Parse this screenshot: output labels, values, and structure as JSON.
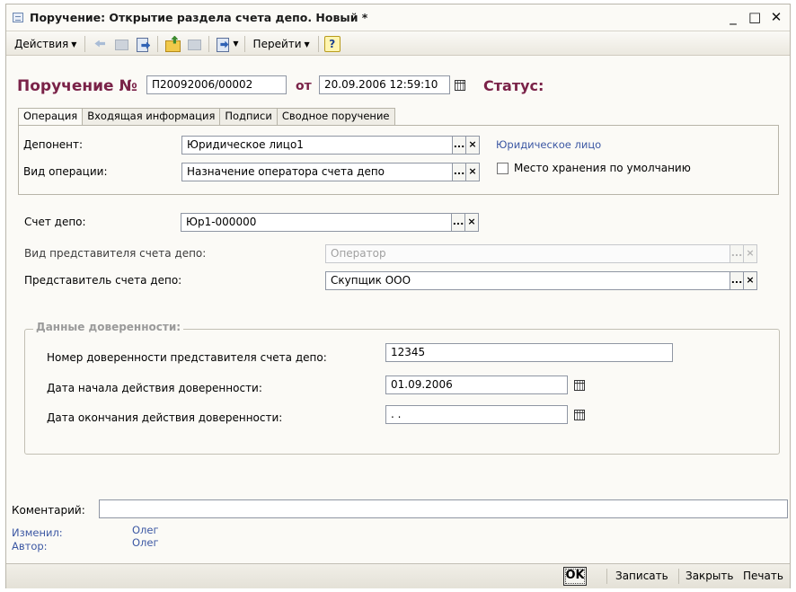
{
  "window": {
    "title": "Поручение: Открытие раздела счета депо. Новый *",
    "minimize": "_",
    "maximize": "□",
    "close": "✕"
  },
  "toolbar": {
    "actions_label": "Действия",
    "goto_label": "Перейти",
    "help_label": "?"
  },
  "header": {
    "order_label": "Поручение №",
    "order_number": "П20092006/00002",
    "from_label": "от",
    "date": "20.09.2006 12:59:10",
    "status_label": "Статус:"
  },
  "tabs": [
    {
      "label": "Операция",
      "active": true
    },
    {
      "label": "Входящая информация",
      "active": false
    },
    {
      "label": "Подписи",
      "active": false
    },
    {
      "label": "Сводное поручение",
      "active": false
    }
  ],
  "operation": {
    "deponent_label": "Депонент:",
    "deponent_value": "Юридическое лицо1",
    "deponent_type": "Юридическое лицо",
    "op_type_label": "Вид операции:",
    "op_type_value": "Назначение оператора счета депо",
    "default_storage_label": "Место хранения по умолчанию",
    "default_storage_checked": false
  },
  "account": {
    "label": "Счет депо:",
    "value": "Юр1-000000"
  },
  "rep_type": {
    "label": "Вид представителя счета депо:",
    "value": "Оператор"
  },
  "representative": {
    "label": "Представитель счета депо:",
    "value": "Скупщик ООО"
  },
  "proxy": {
    "title": "Данные доверенности:",
    "number_label": "Номер доверенности представителя счета депо:",
    "number_value": "12345",
    "start_label": "Дата начала действия доверенности:",
    "start_value": "01.09.2006",
    "end_label": "Дата окончания действия доверенности:",
    "end_value": " .  ."
  },
  "footer": {
    "comment_label": "Коментарий:",
    "comment_value": "",
    "changed_label": "Изменил:",
    "changed_value": "Олег",
    "author_label": "Автор:",
    "author_value": "Олег"
  },
  "statusbar": {
    "ok_label": "OK",
    "save_label": "Записать",
    "close_label": "Закрыть",
    "print_label": "Печать"
  },
  "icons": {
    "pick": "...",
    "clear": "×"
  }
}
